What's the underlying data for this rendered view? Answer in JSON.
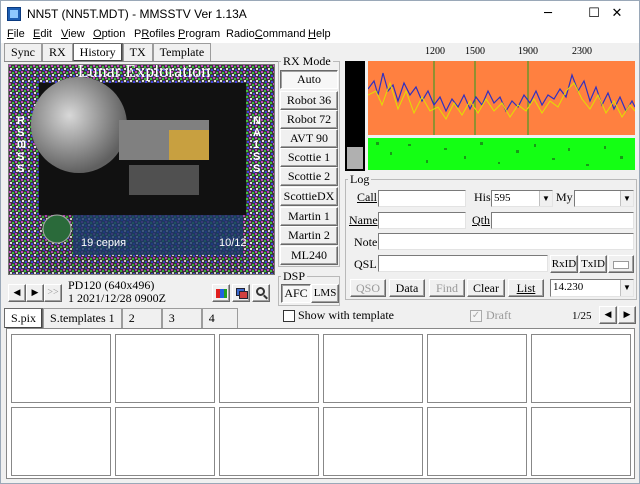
{
  "window": {
    "title": "NN5T (NN5T.MDT) - MMSSTV Ver 1.13A",
    "minimize": "─",
    "maximize": "☐",
    "close": "✕"
  },
  "menu": [
    {
      "pre": "",
      "key": "F",
      "post": "ile"
    },
    {
      "pre": "",
      "key": "E",
      "post": "dit"
    },
    {
      "pre": "",
      "key": "V",
      "post": "iew"
    },
    {
      "pre": "",
      "key": "O",
      "post": "ption"
    },
    {
      "pre": "P",
      "key": "R",
      "post": "ofiles"
    },
    {
      "pre": "",
      "key": "P",
      "post": "rogram"
    },
    {
      "pre": "Radio",
      "key": "C",
      "post": "ommand"
    },
    {
      "pre": "",
      "key": "H",
      "post": "elp"
    }
  ],
  "tabs": [
    {
      "label": "Sync"
    },
    {
      "label": "RX"
    },
    {
      "label": "History",
      "active": true
    },
    {
      "label": "TX"
    },
    {
      "label": "Template"
    }
  ],
  "image": {
    "banner": "Lunar Exploration",
    "left_call": "RS0ISS",
    "right_call": "NA1SS",
    "caption": "19 серия",
    "counter": "10/12"
  },
  "nav": {
    "prev": "◀",
    "next": "▶",
    "skip": ">>"
  },
  "history_info": {
    "mode": "PD120 (640x496)",
    "stamp": "1 2021/12/28 0900Z"
  },
  "rx_mode": {
    "title": "RX Mode",
    "modes": [
      "Auto",
      "Robot 36",
      "Robot 72",
      "AVT 90",
      "Scottie 1",
      "Scottie 2",
      "ScottieDX",
      "Martin 1",
      "Martin 2",
      "ML240"
    ]
  },
  "dsp": {
    "title": "DSP",
    "afc": "AFC",
    "lms": "LMS"
  },
  "spectrum": {
    "ticks": [
      "1200",
      "1500",
      "1900",
      "2300"
    ]
  },
  "log": {
    "title": "Log",
    "call_label": "Call",
    "his_label": "His",
    "his_value": "595",
    "my_label": "My",
    "name_label": "Name",
    "qth_label": "Qth",
    "note_label": "Note",
    "qsl_label": "QSL",
    "rxid": "RxID",
    "txid": "TxID",
    "qso": "QSO",
    "data": "Data",
    "find": "Find",
    "clear": "Clear",
    "list": "List",
    "freq": "14.230"
  },
  "options": {
    "show_with_template": "Show with template",
    "draft": "Draft",
    "page": "1/25"
  },
  "stock_tabs": [
    "S.pix",
    "S.templates 1",
    "2",
    "3",
    "4"
  ],
  "colors": {
    "spectrum_bg": "#ff8040",
    "waterfall_bg": "#14ff14",
    "signal": "#3030c0"
  }
}
